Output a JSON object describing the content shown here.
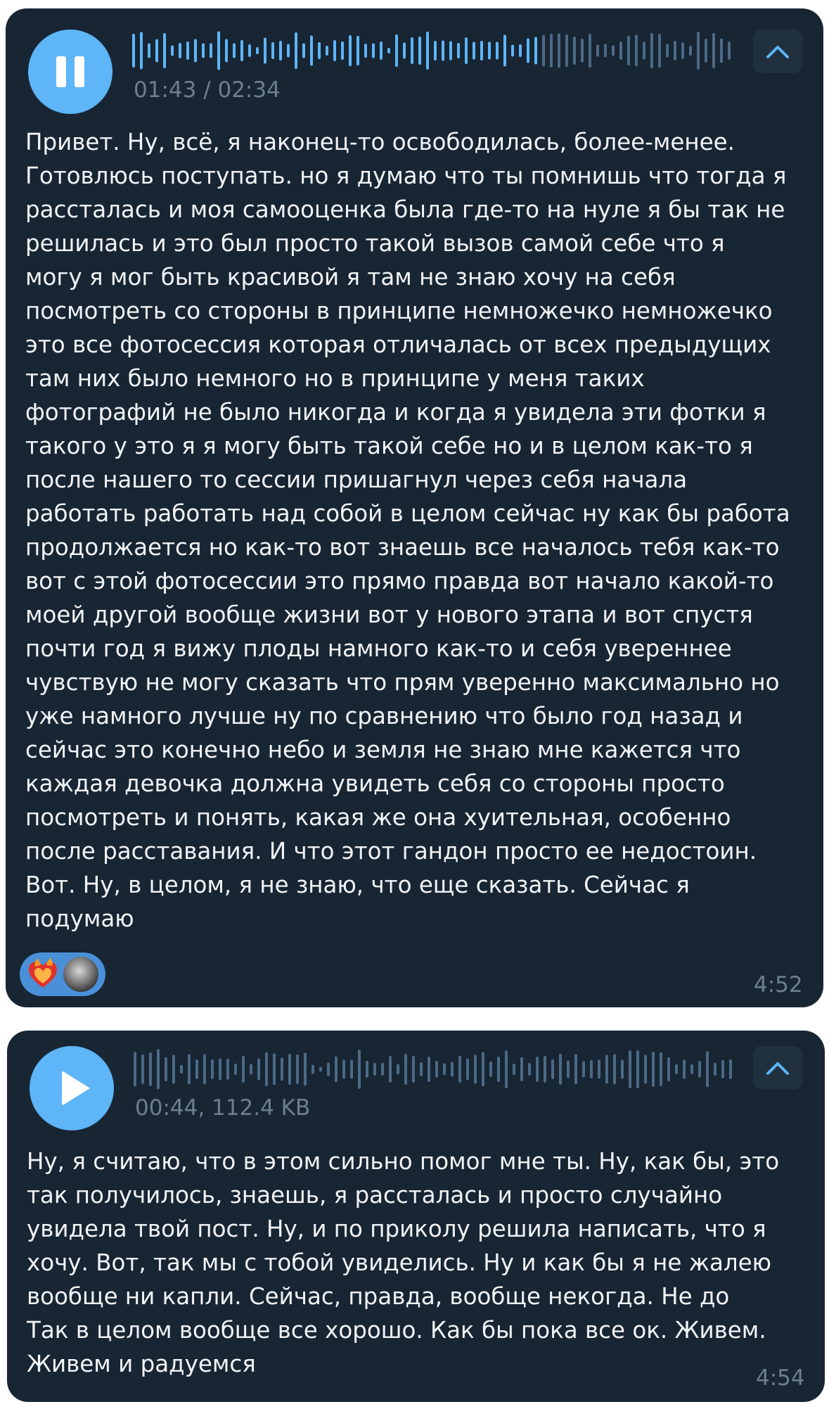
{
  "colors": {
    "bubble_bg": "#182533",
    "accent": "#5eb5f7",
    "text": "#f1f4f7",
    "meta_text": "#6d7f8f",
    "waveform_played": "#5eb5f7",
    "waveform_unplayed": "#4c6a86",
    "reaction_pill": "#4a90d9"
  },
  "messages": [
    {
      "voice": {
        "state": "playing",
        "control_icon": "pause-icon",
        "time_label": "01:43 / 02:34",
        "progress": 0.67,
        "expand_icon": "chevron-up-icon"
      },
      "transcript": [
        "Привет. Ну, всё, я наконец-то освободилась, более-менее.",
        "Готовлюсь поступать. но я думаю что ты помнишь что тогда я",
        "рассталась и моя самооценка была где-то на нуле я бы так не",
        "решилась и это был просто такой вызов самой себе что я",
        "могу я мог быть красивой я там не знаю хочу на себя",
        "посмотреть со стороны в принципе немножечко немножечко",
        "это все фотосессия которая отличалась от всех предыдущих",
        "там них было немного но в принципе у меня таких",
        "фотографий не было никогда и когда я увидела эти фотки я",
        "такого у это я я могу быть такой себе но и в целом как-то я",
        "после нашего то сессии пришагнул через себя начала",
        "работать работать над собой в целом сейчас ну как бы работа",
        "продолжается но как-то вот знаешь все началось тебя как-то",
        "вот с этой фотосессии это прямо правда вот начало какой-то",
        "моей другой вообще жизни вот у нового этапа и вот спустя",
        "почти год я вижу плоды намного как-то и себя увереннее",
        "чувствую не могу сказать что прям уверенно максимально но",
        "уже намного лучше ну по сравнению что было год назад и",
        "сейчас это конечно небо и земля не знаю мне кажется что",
        "каждая девочка должна увидеть себя со стороны просто",
        "посмотреть и понять, какая же она хуительная, особенно",
        "после расставания. И что этот гандон просто ее недостоин.",
        "Вот. Ну, в целом, я не знаю, что еще сказать. Сейчас я",
        "подумаю"
      ],
      "reactions": [
        "burning-heart-icon",
        "user-avatar"
      ],
      "time": "4:52"
    },
    {
      "voice": {
        "state": "paused",
        "control_icon": "play-icon",
        "time_label": "00:44, 112.4 KB",
        "progress": 0,
        "expand_icon": "chevron-up-icon"
      },
      "transcript": [
        "Ну, я считаю, что в этом сильно помог мне ты. Ну, как бы, это",
        "так получилось, знаешь, я рассталась и просто случайно",
        "увидела твой пост. Ну, и по приколу решила написать, что я",
        "хочу. Вот, так мы с тобой увиделись. Ну и как бы я не жалею",
        "вообще ни капли. Сейчас, правда, вообще некогда. Не до",
        "Так в целом вообще все хорошо. Как бы пока все ок. Живем.",
        "Живем и радуемся"
      ],
      "time": "4:54"
    }
  ]
}
